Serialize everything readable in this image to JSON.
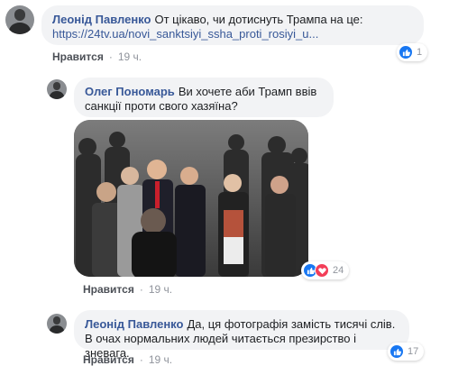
{
  "comments": [
    {
      "author": "Леонід Павленко",
      "text": "От цікаво, чи дотиснуть Трампа на це:",
      "link": "https://24tv.ua/novi_sanktsiyi_ssha_proti_rosiyi_u...",
      "like_label": "Нравится",
      "dot": "·",
      "time": "19 ч.",
      "reaction_count": "1"
    },
    {
      "author": "Олег Пономарь",
      "text": "Ви хочете аби Трамп ввів санкції проти свого хазяїна?",
      "like_label": "Нравится",
      "dot": "·",
      "time": "19 ч.",
      "reaction_count": "24"
    },
    {
      "author": "Леонід Павленко",
      "text": "Да, ця фотографія замість тисячі слів. В очах нормальних людей читається презирство і зневага.",
      "like_label": "Нравится",
      "dot": "·",
      "time": "19 ч.",
      "reaction_count": "17"
    }
  ],
  "colors": {
    "author_link": "#385898",
    "bubble_bg": "#f2f3f5",
    "like_blue": "#1877f2",
    "love_red": "#f33e58"
  }
}
